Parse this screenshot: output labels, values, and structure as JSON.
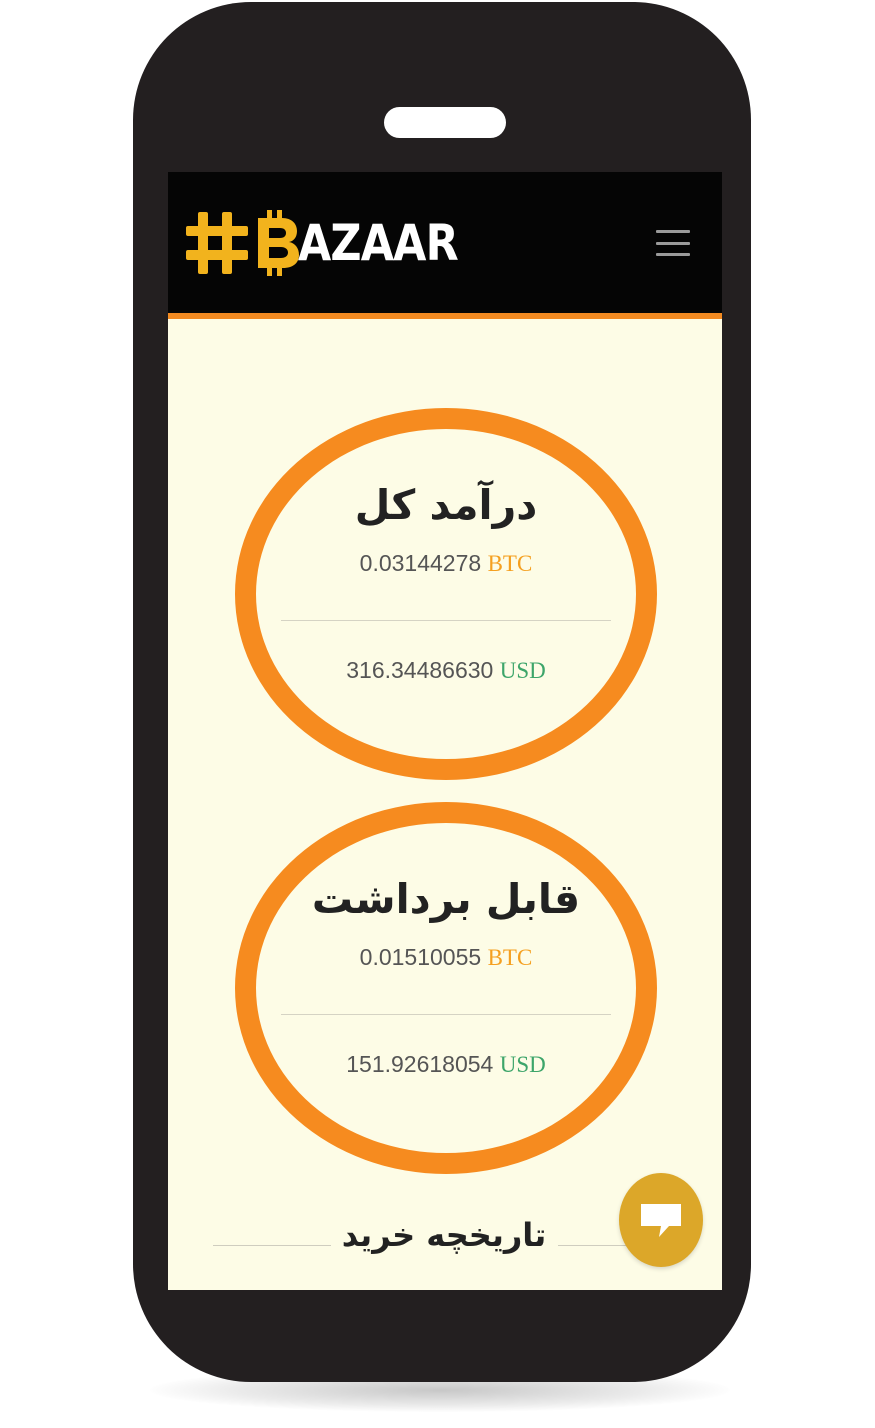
{
  "brand": {
    "logo_text": "AZAAR",
    "colors": {
      "accent": "#f68b1f",
      "nav_bg": "#050505",
      "screen_bg": "#fdfce6",
      "logo_gold": "#f2b31d"
    }
  },
  "header": {
    "menu_icon": "hamburger-menu-icon"
  },
  "cards": [
    {
      "title": "درآمد کل",
      "btc_value": "0.03144278",
      "btc_unit": "BTC",
      "usd_value": "316.34486630",
      "usd_unit": "USD"
    },
    {
      "title": "قابل برداشت",
      "btc_value": "0.01510055",
      "btc_unit": "BTC",
      "usd_value": "151.92618054",
      "usd_unit": "USD"
    }
  ],
  "history": {
    "title": "تاریخچه خرید"
  },
  "chat": {
    "icon": "chat-bubble-icon",
    "color": "#dca729"
  }
}
